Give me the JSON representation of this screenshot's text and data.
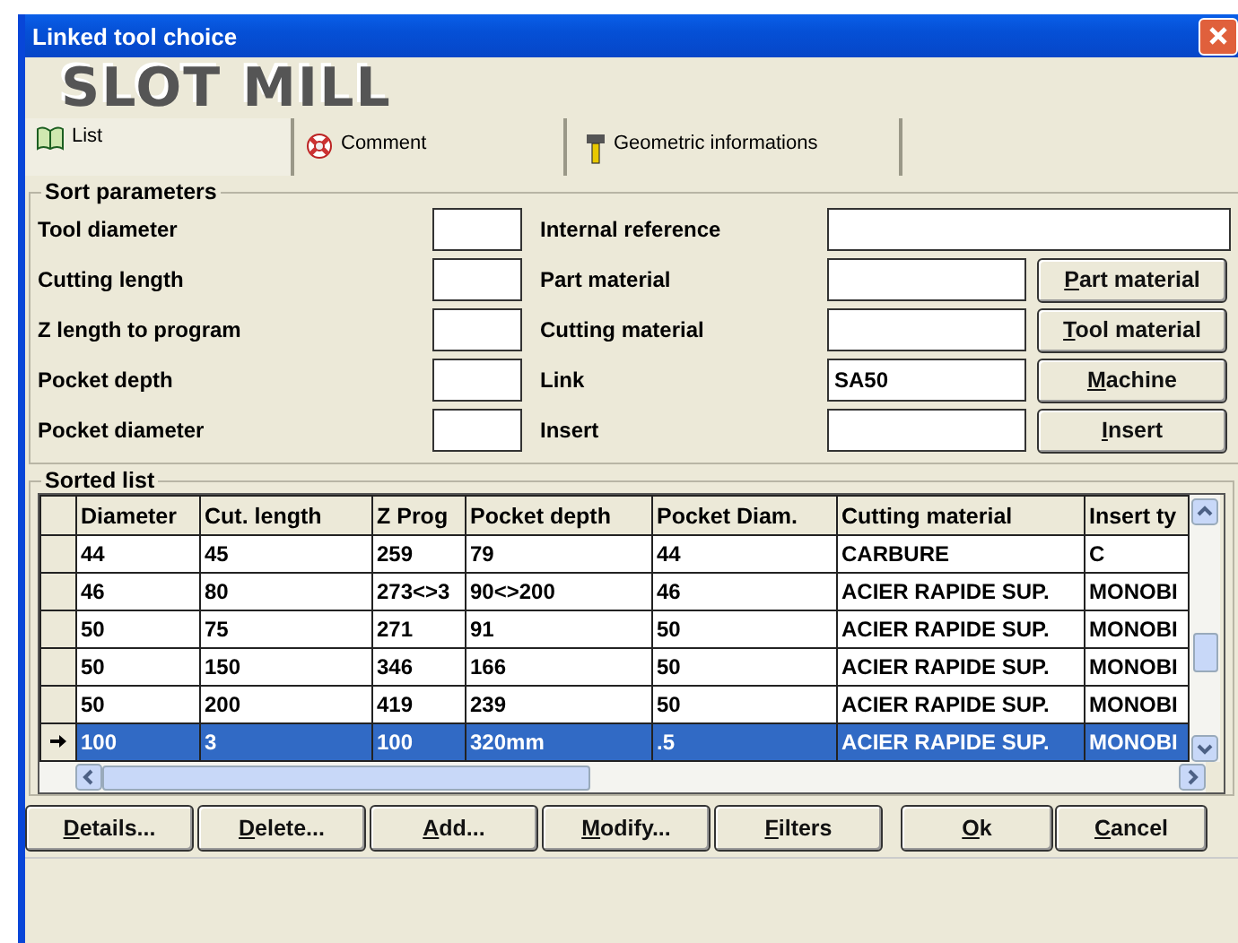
{
  "window": {
    "title": "Linked tool choice"
  },
  "banner": "SLOT MILL",
  "tabs": [
    {
      "label": "List",
      "selected": true
    },
    {
      "label": "Comment",
      "selected": false
    },
    {
      "label": "Geometric informations",
      "selected": false
    }
  ],
  "sort_parameters": {
    "title": "Sort parameters",
    "left_fields": [
      {
        "label": "Tool diameter"
      },
      {
        "label": "Cutting length"
      },
      {
        "label": "Z length to program"
      },
      {
        "label": "Pocket depth"
      },
      {
        "label": "Pocket diameter"
      }
    ],
    "right_fields": [
      {
        "label": "Internal reference"
      },
      {
        "label": "Part material"
      },
      {
        "label": "Cutting material"
      },
      {
        "label": "Link",
        "value": "SA50"
      },
      {
        "label": "Insert"
      }
    ],
    "buttons": [
      {
        "key": "P",
        "rest": "art material"
      },
      {
        "key": "T",
        "rest": "ool material"
      },
      {
        "key": "M",
        "rest": "achine"
      },
      {
        "key": "I",
        "rest": "nsert"
      }
    ]
  },
  "sorted_list": {
    "title": "Sorted list",
    "columns": [
      "Diameter",
      "Cut. length",
      "Z Prog",
      "Pocket depth",
      "Pocket Diam.",
      "Cutting material",
      "Insert ty"
    ],
    "rows": [
      {
        "cells": [
          "44",
          "45",
          "259",
          "79",
          "44",
          "CARBURE",
          "C"
        ],
        "selected": false
      },
      {
        "cells": [
          "46",
          "80",
          "273<>3",
          "90<>200",
          "46",
          "ACIER RAPIDE SUP.",
          "MONOBI"
        ],
        "selected": false
      },
      {
        "cells": [
          "50",
          "75",
          "271",
          "91",
          "50",
          "ACIER RAPIDE SUP.",
          "MONOBI"
        ],
        "selected": false
      },
      {
        "cells": [
          "50",
          "150",
          "346",
          "166",
          "50",
          "ACIER RAPIDE SUP.",
          "MONOBI"
        ],
        "selected": false
      },
      {
        "cells": [
          "50",
          "200",
          "419",
          "239",
          "50",
          "ACIER RAPIDE SUP.",
          "MONOBI"
        ],
        "selected": false
      },
      {
        "cells": [
          "100",
          "3",
          "100",
          "320mm",
          ".5",
          "ACIER RAPIDE SUP.",
          "MONOBI"
        ],
        "selected": true
      }
    ]
  },
  "action_buttons": [
    {
      "key": "D",
      "rest": "etails..."
    },
    {
      "key": "D",
      "rest": "elete..."
    },
    {
      "key": "A",
      "rest": "dd..."
    },
    {
      "key": "M",
      "rest": "odify..."
    },
    {
      "key": "F",
      "rest": "ilters"
    }
  ],
  "dialog_buttons": [
    {
      "key": "O",
      "rest": "k"
    },
    {
      "key": "C",
      "rest": "ancel"
    }
  ]
}
